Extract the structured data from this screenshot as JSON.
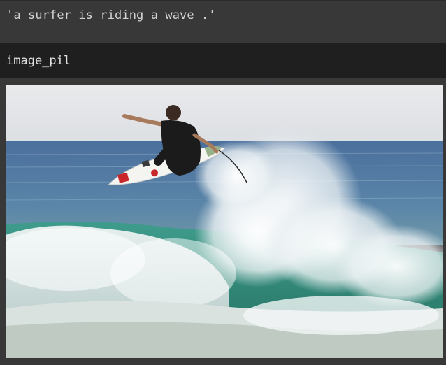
{
  "output": {
    "text": "'a surfer is riding a wave .'"
  },
  "image_section": {
    "label": "image_pil"
  },
  "photo": {
    "icon": "surfer-photo"
  }
}
